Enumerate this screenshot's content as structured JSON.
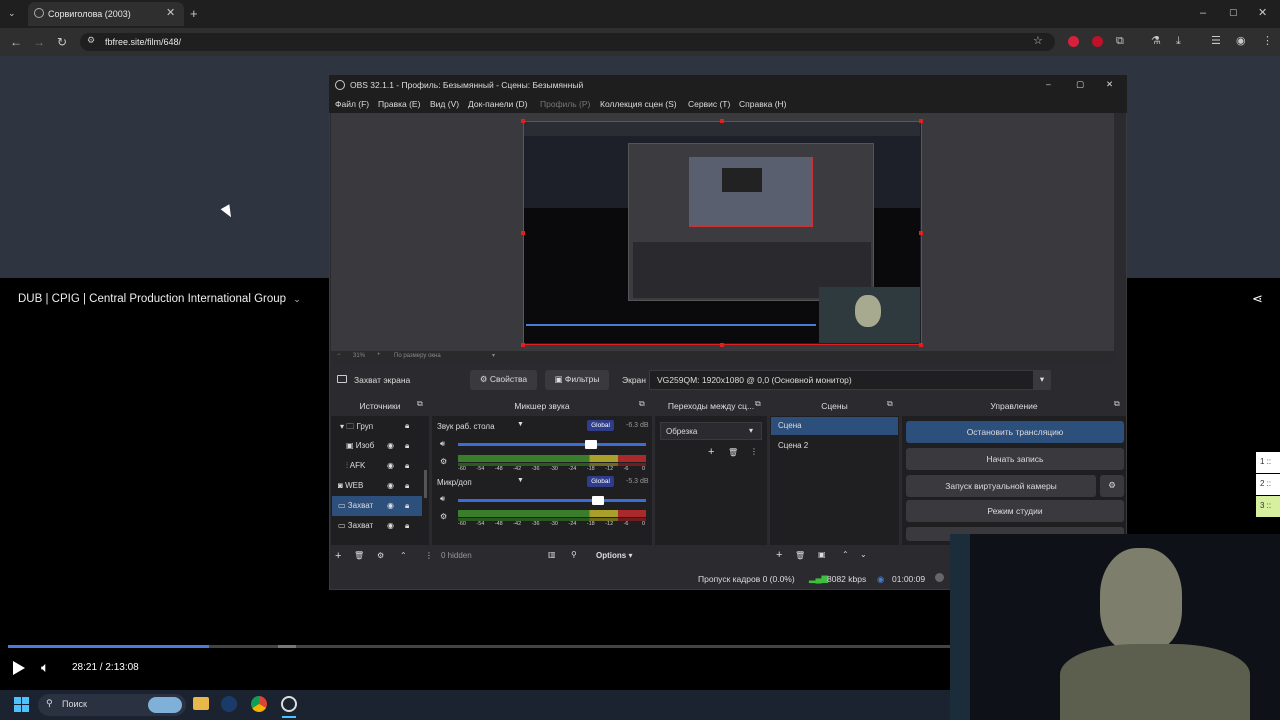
{
  "browser": {
    "tab_title": "Сорвиголова (2003)",
    "url": "fbfree.site/film/648/"
  },
  "video": {
    "title": "DUB | CPIG | Central Production International Group",
    "time": "28:21 / 2:13:08",
    "progress_fraction": 0.213
  },
  "obs": {
    "title": "OBS 32.1.1 - Профиль: Безымянный - Сцены: Безымянный",
    "menu": [
      "Файл (F)",
      "Правка (E)",
      "Вид (V)",
      "Док-панели (D)",
      "Профиль (P)",
      "Коллекция сцен (S)",
      "Сервис (T)",
      "Справка (H)"
    ],
    "zoom": {
      "minus": "−",
      "percent": "31%",
      "plus": "+",
      "fit": "По размеру окна"
    },
    "source_bar": {
      "selected": "Захват экрана",
      "properties": "Свойства",
      "filters": "Фильтры",
      "screen_label": "Экран",
      "screen_value": "VG259QM: 1920x1080 @ 0,0 (Основной монитор)"
    },
    "docks": {
      "sources": "Источники",
      "mixer": "Микшер звука",
      "transitions": "Переходы между сц...",
      "scenes": "Сцены",
      "controls": "Управление"
    },
    "sources": [
      "Груп",
      "Изоб",
      "AFK",
      "WEB",
      "Захват",
      "Захват"
    ],
    "mixer": [
      {
        "name": "Звук раб. стола",
        "tag": "Global",
        "db": "-6.3 dB",
        "level": 0.92
      },
      {
        "name": "Микр/доп",
        "tag": "Global",
        "db": "-5.3 dB",
        "level": 0.96
      }
    ],
    "meter_ticks": [
      "-60",
      "-54",
      "-48",
      "-42",
      "-36",
      "-30",
      "-24",
      "-18",
      "-12",
      "-6",
      "0"
    ],
    "mixer_footer": {
      "hidden": "0 hidden",
      "options": "Options"
    },
    "transition": "Обрезка",
    "scenes": [
      "Сцена",
      "Сцена 2"
    ],
    "controls": [
      "Остановить трансляцию",
      "Начать запись",
      "Запуск виртуальной камеры",
      "Режим студии"
    ],
    "status": {
      "dropped": "Пропуск кадров 0 (0.0%)",
      "bitrate": "8082 kbps",
      "time": "01:00:09"
    }
  },
  "side_items": [
    "1 ::",
    "2 ::",
    "3 ::"
  ],
  "taskbar": {
    "search": "Поиск"
  },
  "colors": {
    "accent": "#4a7bd8",
    "selection_border": "#e0201e",
    "obs_highlight": "#2d4f7c"
  }
}
